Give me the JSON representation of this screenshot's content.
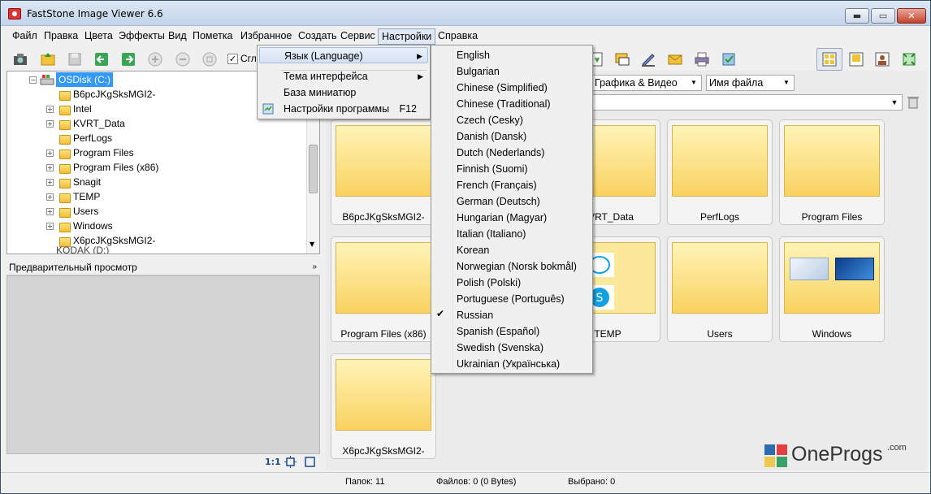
{
  "window": {
    "title": "FastStone Image Viewer 6.6",
    "min": "▬",
    "max": "▭",
    "close": "✕"
  },
  "menubar": [
    "Файл",
    "Правка",
    "Цвета",
    "Эффекты",
    "Вид",
    "Пометка",
    "Избранное",
    "Создать",
    "Сервис",
    "Настройки",
    "Справка"
  ],
  "toolbar": {
    "smooth_label": "Сгла"
  },
  "filters": {
    "type": "Графика & Видео",
    "sort": "Имя файла"
  },
  "tree": {
    "root": "OSDisk (C:)",
    "items": [
      "B6pcJKgSksMGI2-",
      "Intel",
      "KVRT_Data",
      "PerfLogs",
      "Program Files",
      "Program Files (x86)",
      "Snagit",
      "TEMP",
      "Users",
      "Windows",
      "X6pcJKgSksMGI2-"
    ],
    "partial": "KODAK (D:)"
  },
  "preview": {
    "title": "Предварительный просмотр",
    "scale": "1:1"
  },
  "thumbs": [
    "B6pcJKgSksMGI2-",
    "KVRT_Data",
    "PerfLogs",
    "Program Files",
    "Program Files (x86)",
    "TEMP",
    "Users",
    "Windows",
    "X6pcJKgSksMGI2-"
  ],
  "status": {
    "folders": "Папок: 11",
    "files": "Файлов: 0 (0 Bytes)",
    "selected": "Выбрано: 0"
  },
  "settings_menu": [
    {
      "label": "Язык (Language)",
      "submenu": true
    },
    {
      "label": "Тема интерфейса",
      "submenu": true
    },
    {
      "label": "База миниатюр"
    },
    {
      "label": "Настройки программы",
      "shortcut": "F12"
    }
  ],
  "languages": [
    "English",
    "Bulgarian",
    "Chinese (Simplified)",
    "Chinese (Traditional)",
    "Czech (Cesky)",
    "Danish (Dansk)",
    "Dutch (Nederlands)",
    "Finnish (Suomi)",
    "French (Français)",
    "German (Deutsch)",
    "Hungarian (Magyar)",
    "Italian (Italiano)",
    "Korean",
    "Norwegian (Norsk bokmål)",
    "Polish (Polski)",
    "Portuguese (Português)",
    "Russian",
    "Spanish (Español)",
    "Swedish (Svenska)",
    "Ukrainian (Українська)"
  ],
  "selected_language": "Russian",
  "watermark": {
    "text": "OneProgs",
    "sup": ".com"
  }
}
